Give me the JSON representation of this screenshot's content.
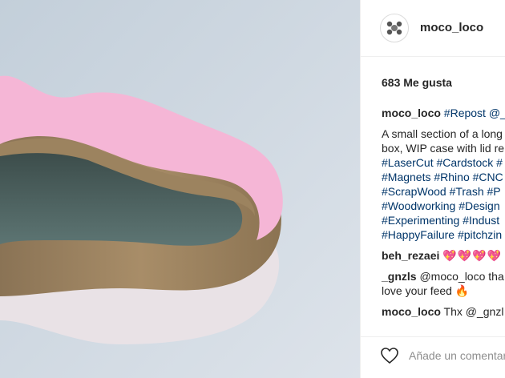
{
  "post": {
    "author": "moco_loco",
    "likes_text": "683 Me gusta"
  },
  "comments": [
    {
      "user": "moco_loco",
      "text": "#Repost @_gnzls",
      "is_hashtag_text": true
    }
  ],
  "caption_lines": [
    "A small section of a long",
    "box, WIP case with lid re",
    "#LaserCut #Cardstock #",
    "#Magnets #Rhino #CNC",
    "#ScrapWood #Trash #P",
    "#Woodworking #Design",
    "#Experimenting #Indust",
    "#HappyFailure #pitchzin"
  ],
  "reply1": {
    "user": "beh_rezaei",
    "text": "💖💖💖💖"
  },
  "reply2": {
    "user": "_gnzls",
    "line1": "@moco_loco tha",
    "line2": "love your feed",
    "emoji": "🔥"
  },
  "reply3": {
    "user": "moco_loco",
    "text": "Thx @_gnzl"
  },
  "add_comment": {
    "placeholder": "Añade un comentario..."
  },
  "icons": {
    "like": "heart-outline-icon",
    "avatar": "avatar-logo"
  }
}
